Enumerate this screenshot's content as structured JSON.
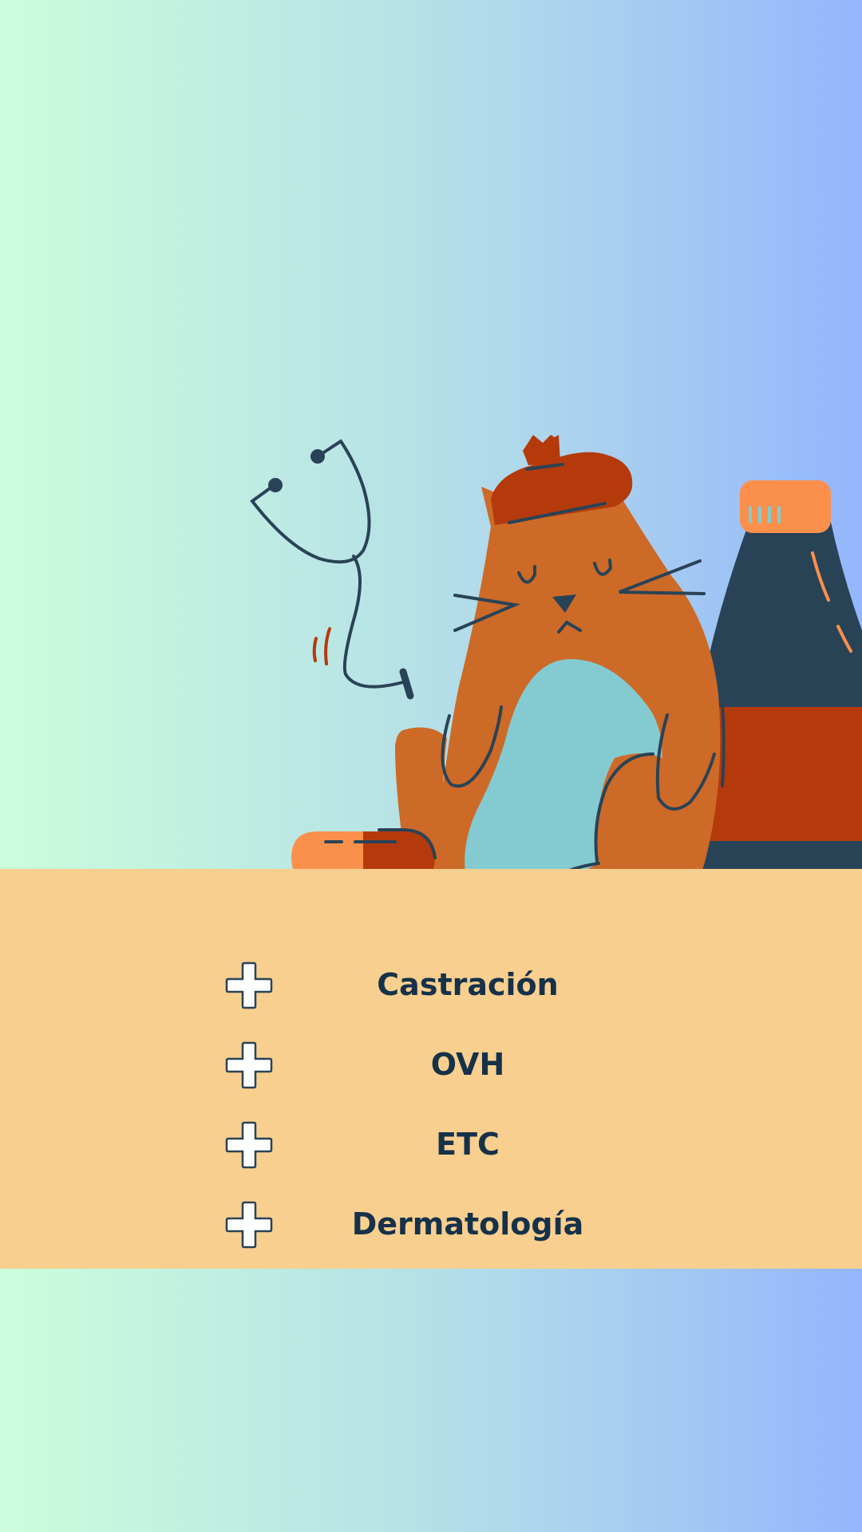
{
  "colors": {
    "background_left": "#ccfddb",
    "background_right": "#93b6fd",
    "panel": "#f8cf8e",
    "text": "#16314a",
    "cat_body": "#cd6a27",
    "cat_belly": "#84cbd1",
    "beret": "#b53a0b",
    "bottle": "#294356",
    "bottle_label": "#b53a0b",
    "bottle_cap": "#fb904d",
    "pill_light": "#fb904d",
    "pill_dark": "#b53a0b"
  },
  "illustration": {
    "icons": [
      "stethoscope-icon",
      "cat-illustration",
      "beret",
      "medicine-bottle",
      "pill-capsule"
    ]
  },
  "services": [
    {
      "icon": "cross-icon",
      "label": "Castración"
    },
    {
      "icon": "cross-icon",
      "label": "OVH"
    },
    {
      "icon": "cross-icon",
      "label": "ETC"
    },
    {
      "icon": "cross-icon",
      "label": "Dermatología"
    }
  ]
}
